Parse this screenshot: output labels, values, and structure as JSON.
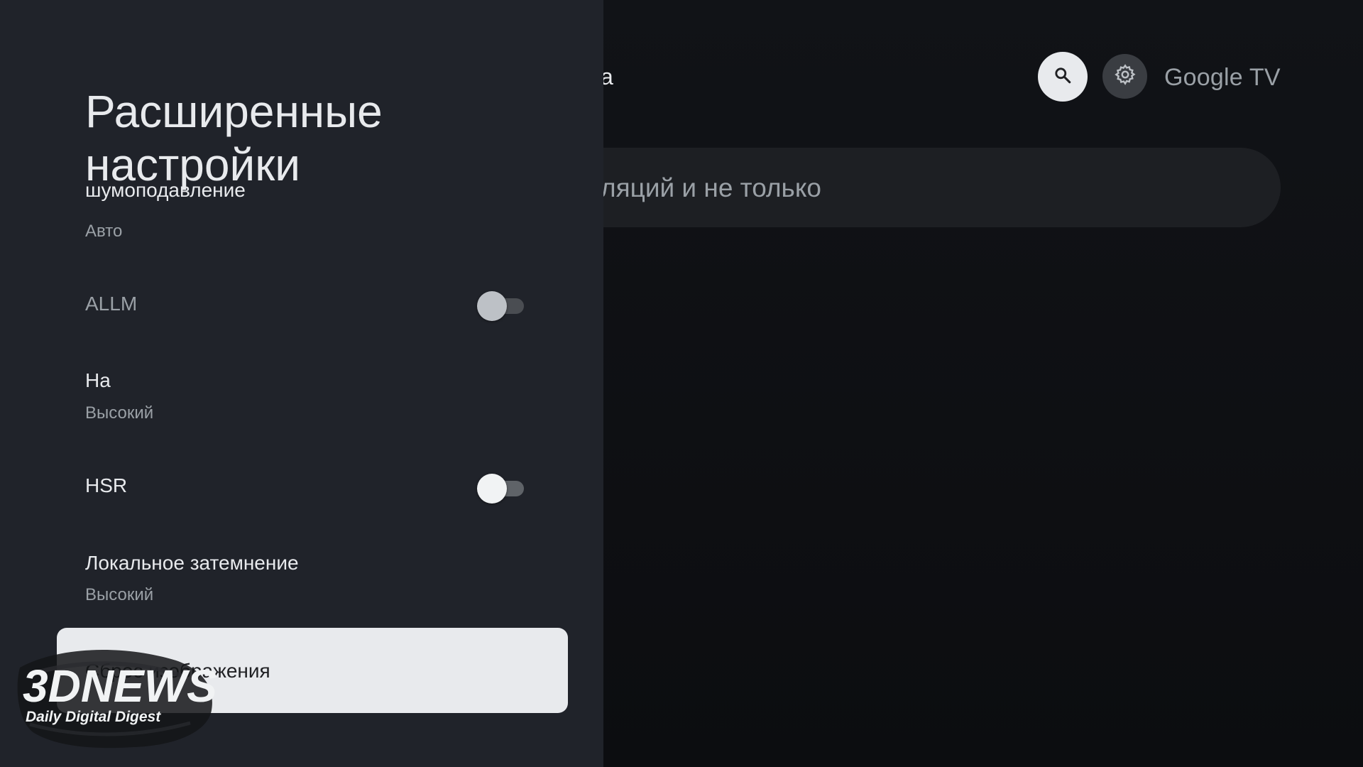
{
  "background": {
    "tab_fragment": "а",
    "search_button_icon": "search-icon",
    "settings_button_icon": "gear-icon",
    "brand": "Google TV",
    "search_placeholder_fragment": "ляций и не только"
  },
  "panel": {
    "title": "Расширенные настройки",
    "items": [
      {
        "title": "шумоподавление",
        "subtitle": "Авто"
      },
      {
        "title": "ALLM",
        "toggle": false,
        "enabled": false
      },
      {
        "title": "На",
        "subtitle": "Высокий"
      },
      {
        "title": "HSR",
        "toggle": false,
        "enabled": true
      },
      {
        "title": "Локальное затемнение",
        "subtitle": "Высокий"
      },
      {
        "title": "Сброс изображения",
        "focused": true
      }
    ]
  },
  "watermark": {
    "logo_text": "3DNEWS",
    "tagline": "Daily Digital Digest"
  },
  "colors": {
    "panel_bg": "#20232a",
    "focus_bg": "#e8eaed",
    "text_primary": "#e8eaed",
    "text_secondary": "#9aa0a6"
  }
}
